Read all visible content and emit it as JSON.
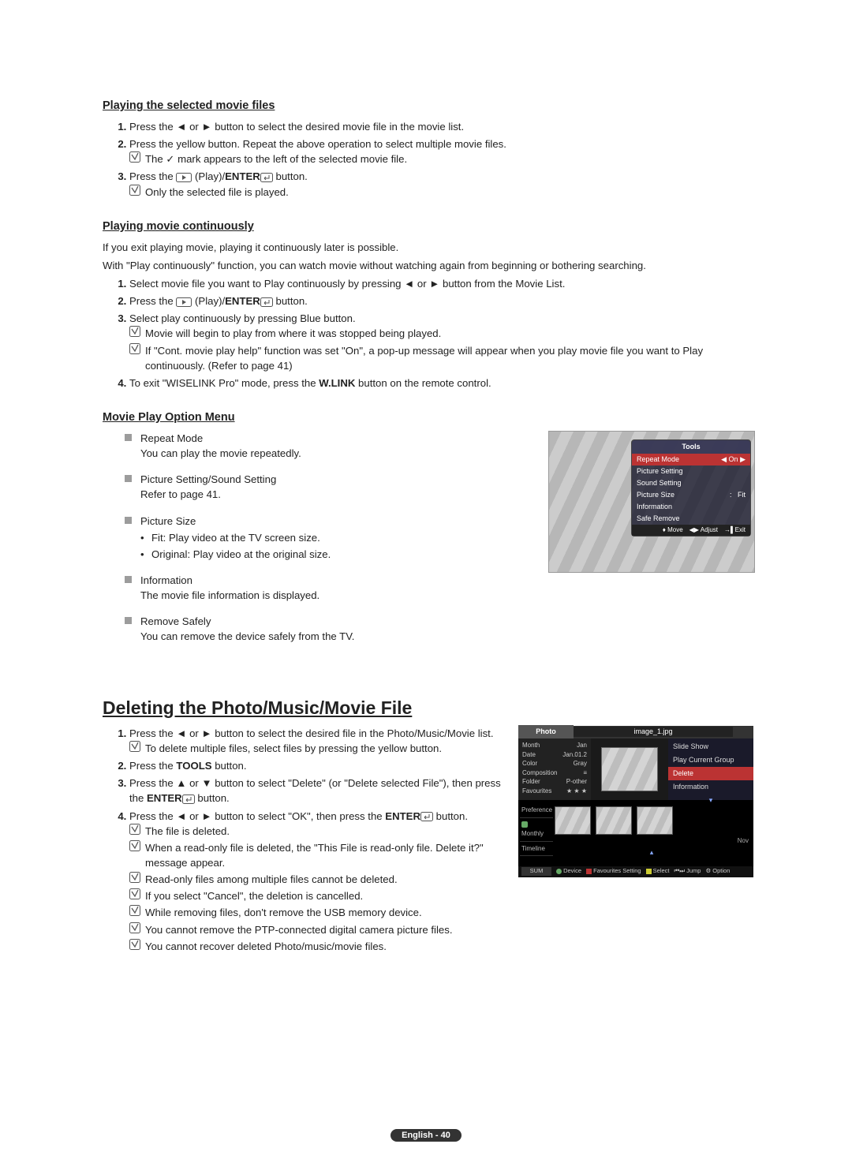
{
  "s1": {
    "title": "Playing the selected movie files",
    "li1": "Press the ◄ or ► button to select the desired movie file in the movie list.",
    "li2": "Press the yellow button. Repeat the above operation to select multiple movie files.",
    "li2_note": "The ✓ mark appears to the left of the selected movie file.",
    "li3a": "Press the ",
    "li3b": " (Play)/",
    "li3c": "ENTER",
    "li3d": " button.",
    "li3_note": "Only the selected file is played."
  },
  "s2": {
    "title": "Playing movie continuously",
    "intro1": "If you exit playing movie, playing it continuously later is possible.",
    "intro2": "With \"Play continuously\" function, you can watch movie without watching again from beginning or bothering searching.",
    "li1": "Select movie file you want to Play continuously by pressing ◄ or ► button from the Movie List.",
    "li2a": "Press the ",
    "li2b": " (Play)/",
    "li2c": "ENTER",
    "li2d": " button.",
    "li3": "Select play continuously by pressing Blue button.",
    "li3_note1": "Movie will begin to play from where it was stopped being played.",
    "li3_note2": "If \"Cont. movie play help\" function was set \"On\", a pop-up message will appear when you play movie file you want to Play continuously. (Refer to page 41)",
    "li4a": "To exit \"WISELINK Pro\" mode, press the ",
    "li4b": "W.LINK",
    "li4c": " button on the remote control."
  },
  "s3": {
    "title": "Movie Play Option Menu",
    "items": [
      {
        "head": "Repeat Mode",
        "body": "You can play the movie repeatedly."
      },
      {
        "head": "Picture Setting/Sound Setting",
        "body": "Refer to page 41."
      },
      {
        "head": "Picture Size",
        "sub": [
          "Fit: Play video at the TV screen size.",
          "Original: Play video at the original size."
        ]
      },
      {
        "head": "Information",
        "body": "The movie file information is displayed."
      },
      {
        "head": "Remove Safely",
        "body": "You can remove the device safely from the TV."
      }
    ]
  },
  "tools_osd": {
    "title": "Tools",
    "rows": [
      {
        "label": "Repeat Mode",
        "value": "On",
        "sel": true,
        "arrows": true
      },
      {
        "label": "Picture Setting"
      },
      {
        "label": "Sound Setting"
      },
      {
        "label": "Picture Size",
        "value": "Fit",
        "colon": true
      },
      {
        "label": "Information"
      },
      {
        "label": "Safe Remove"
      }
    ],
    "footer": {
      "move": "Move",
      "adjust": "Adjust",
      "exit": "Exit"
    }
  },
  "s4": {
    "title": "Deleting the Photo/Music/Movie File",
    "li1": "Press the ◄ or ► button to select the desired file in the Photo/Music/Movie list.",
    "li1_note": "To delete multiple files, select files by pressing the yellow button.",
    "li2a": "Press the ",
    "li2b": "TOOLS",
    "li2c": " button.",
    "li3a": "Press the ▲ or ▼ button to select \"Delete\" (or \"Delete selected File\"), then press the ",
    "li3b": "ENTER",
    "li3c": " button.",
    "li4a": "Press the ◄ or ► button to select \"OK\", then press the ",
    "li4b": "ENTER",
    "li4c": " button.",
    "notes": [
      "The file is deleted.",
      "When a read-only file is deleted, the \"This File is read-only file. Delete it?\" message appear.",
      "Read-only files among multiple files cannot be deleted.",
      "If you select \"Cancel\", the deletion is cancelled.",
      "While removing files, don't remove the USB memory device.",
      "You cannot remove the PTP-connected digital camera picture files.",
      "You cannot recover deleted Photo/music/movie files."
    ]
  },
  "photo_osd": {
    "tab": "Photo",
    "filename": "image_1.jpg",
    "meta": {
      "Month": "Jan",
      "Date": "Jan.01.2",
      "Color": "Gray",
      "Composition": "≡",
      "Folder": "P-other",
      "Favourites": "★ ★ ★"
    },
    "menu": [
      "Slide Show",
      "Play Current Group",
      "Delete",
      "Information"
    ],
    "menu_sel": 2,
    "side": [
      "Preference",
      "Monthly",
      "Timeline"
    ],
    "nov": "Nov",
    "sum": "SUM",
    "foot": [
      "Device",
      "Favourites Setting",
      "Select",
      "Jump",
      "Option"
    ]
  },
  "footer": "English - 40"
}
